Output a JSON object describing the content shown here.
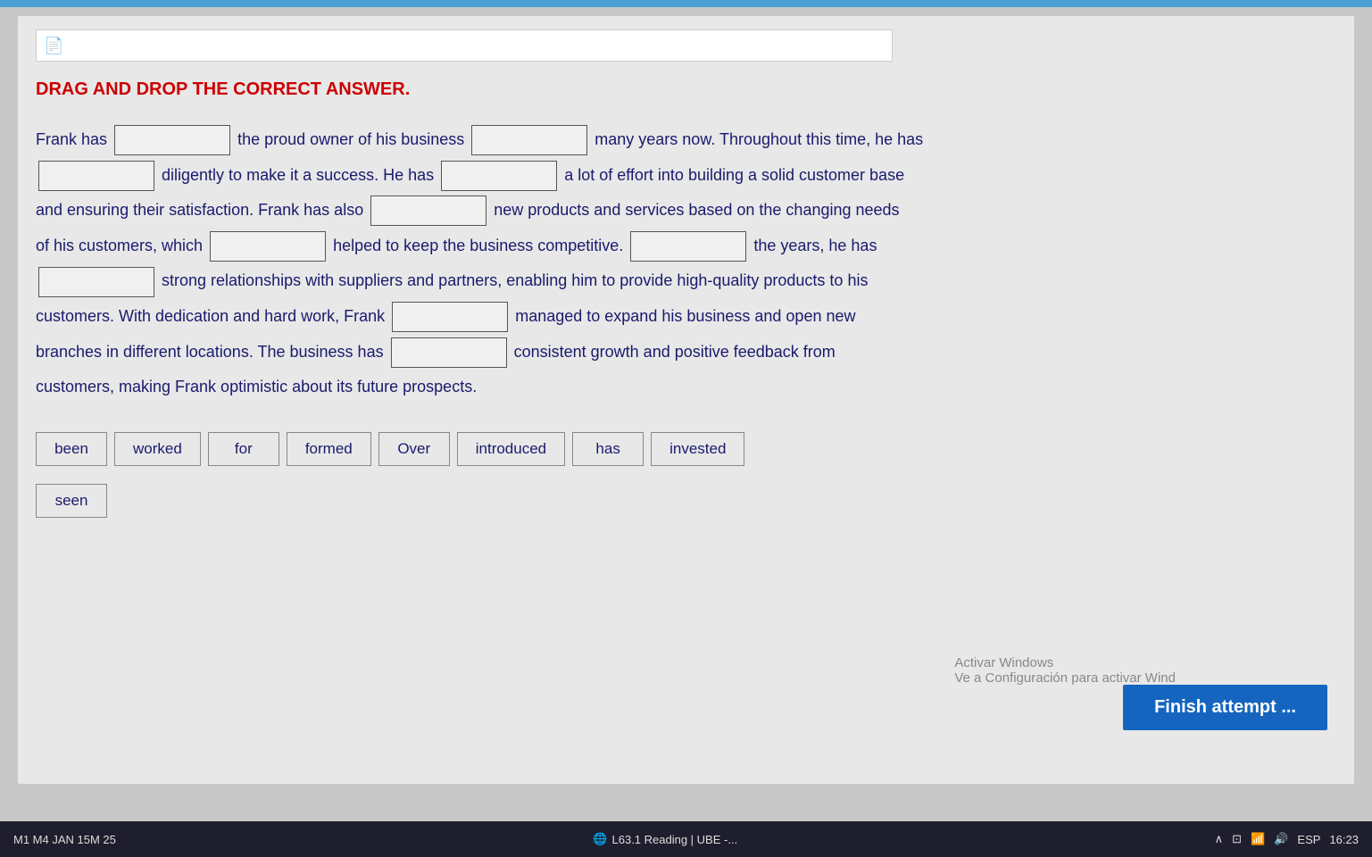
{
  "topbar": {
    "color": "#4a9fd4"
  },
  "browser": {
    "icon": "📄"
  },
  "instruction": {
    "title": "DRAG AND DROP THE CORRECT ANSWER."
  },
  "passage": {
    "line1_start": "Frank has",
    "line1_mid": "the proud owner of his business",
    "line1_end": "many years now. Throughout this time, he has",
    "line2_start": "diligently to make it a success. He has",
    "line2_end": "a lot of effort into building a solid customer base",
    "line3": "and ensuring their satisfaction. Frank has also",
    "line3_end": "new products and services based on the changing needs",
    "line4_start": "of his customers, which",
    "line4_end": "helped to keep the business competitive.",
    "line4_after": "the years, he has",
    "line5_start": "strong relationships with suppliers and partners, enabling him to provide high-quality products to his",
    "line6_start": "customers. With dedication and hard work, Frank",
    "line6_end": "managed to expand his business and open new",
    "line7_start": "branches in different locations. The business has",
    "line7_end": "consistent growth and positive feedback from",
    "line8": "customers, making Frank optimistic about its future prospects."
  },
  "word_bank": {
    "words": [
      "been",
      "worked",
      "for",
      "formed",
      "Over",
      "introduced",
      "has",
      "invested",
      "seen"
    ]
  },
  "buttons": {
    "finish": "Finish attempt ..."
  },
  "activar": {
    "line1": "Activar Wi",
    "line2": "Ve a Configura",
    "suffix": "dows."
  },
  "taskbar": {
    "left_text": "M1 M4 JAN 15M 25",
    "center_text": "L63.1 Reading | UBE -...",
    "time": "16:23",
    "lang": "ESP"
  }
}
